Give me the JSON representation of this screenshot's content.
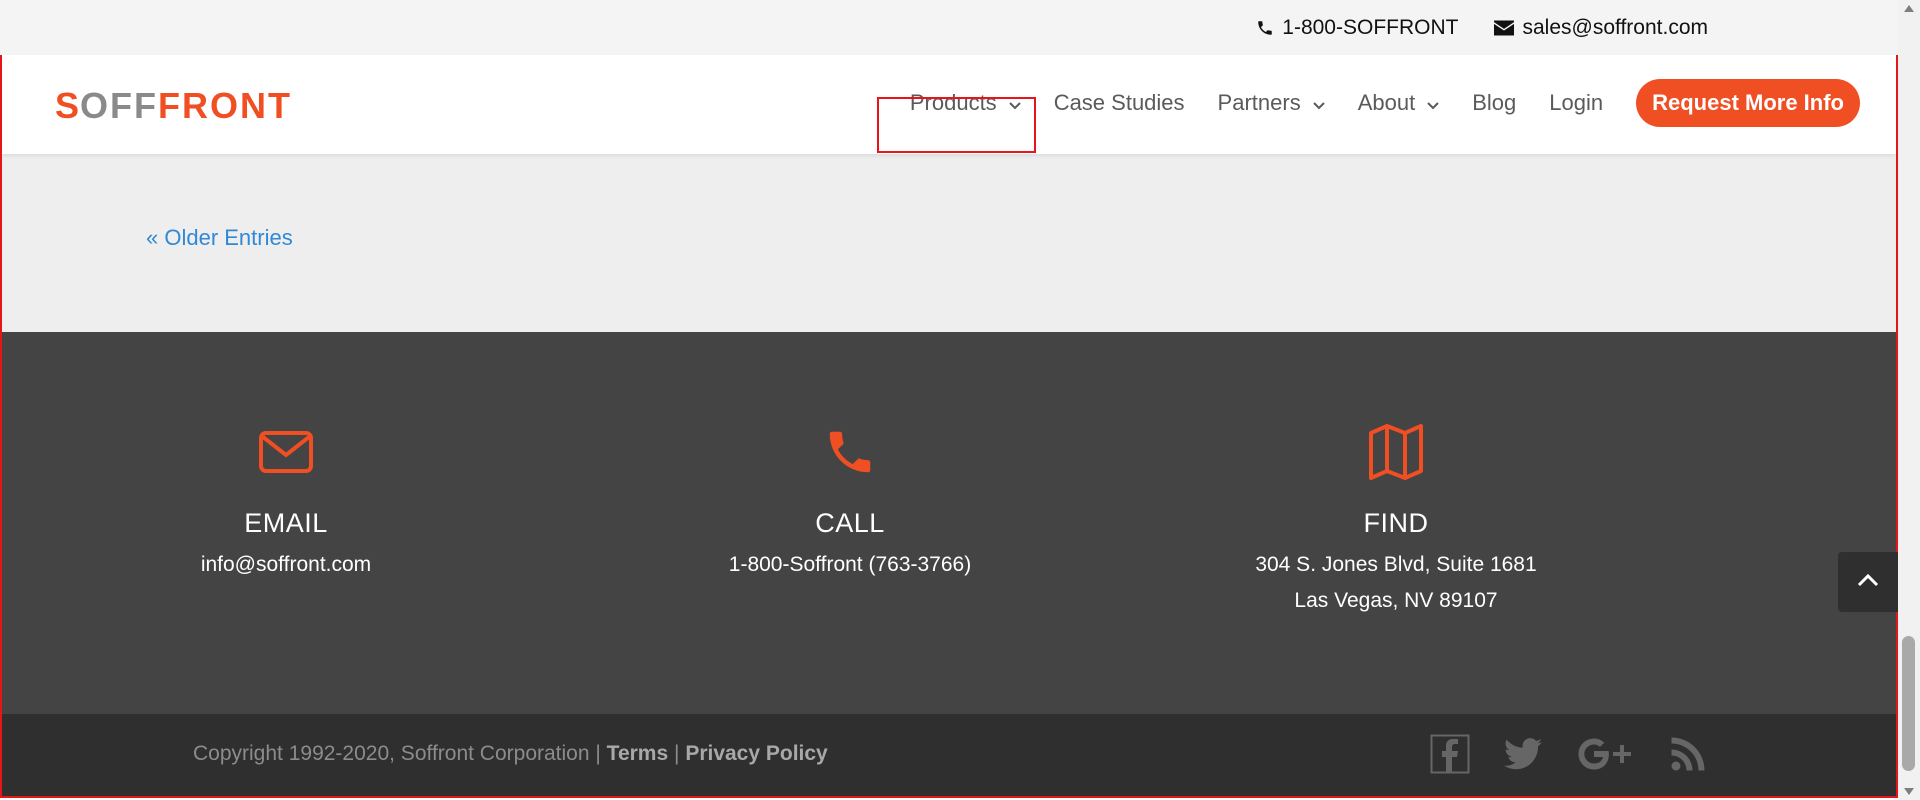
{
  "topbar": {
    "phone": "1-800-SOFFRONT",
    "email": "sales@soffront.com"
  },
  "logo": {
    "text_s": "S",
    "text_off": "OFF",
    "text_front": "FRONT"
  },
  "nav": {
    "items": [
      {
        "label": "Products",
        "has_dropdown": true
      },
      {
        "label": "Case Studies",
        "has_dropdown": false
      },
      {
        "label": "Partners",
        "has_dropdown": true
      },
      {
        "label": "About",
        "has_dropdown": true
      },
      {
        "label": "Blog",
        "has_dropdown": false
      },
      {
        "label": "Login",
        "has_dropdown": false
      }
    ],
    "cta": "Request More Info"
  },
  "main": {
    "older_entries": "« Older Entries"
  },
  "footer": {
    "columns": [
      {
        "icon": "envelope-icon",
        "title": "EMAIL",
        "lines": [
          "info@soffront.com"
        ]
      },
      {
        "icon": "phone-icon",
        "title": "CALL",
        "lines": [
          "1-800-Soffront (763-3766)"
        ]
      },
      {
        "icon": "map-icon",
        "title": "FIND",
        "lines": [
          "304 S. Jones Blvd, Suite 1681",
          "Las Vegas, NV 89107"
        ]
      }
    ],
    "copyright": "Copyright 1992-2020, Soffront Corporation |",
    "terms": "Terms",
    "separator": "|",
    "privacy": "Privacy Policy",
    "social": [
      "facebook-icon",
      "twitter-icon",
      "google-plus-icon",
      "rss-icon"
    ]
  },
  "colors": {
    "brand": "#f04e23",
    "link": "#3189d4",
    "footer_bg": "#444444",
    "bottom_bg": "#2f2f2f",
    "highlight": "#e8141b"
  }
}
